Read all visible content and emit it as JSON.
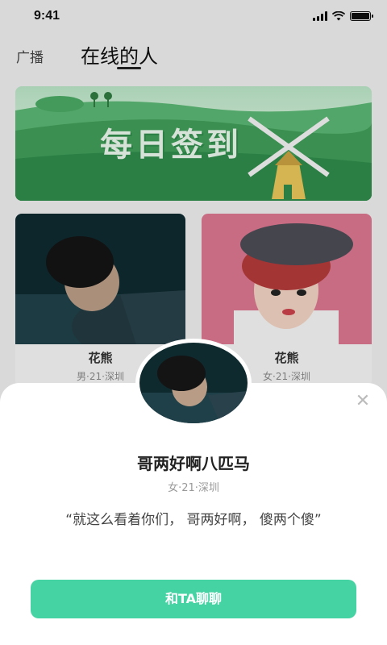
{
  "status_bar": {
    "time": "9:41"
  },
  "tabs": {
    "broadcast": "广播",
    "online": "在线的人"
  },
  "banner": {
    "title": "每日签到"
  },
  "cards": [
    {
      "name": "花熊",
      "meta": "男·21·深圳"
    },
    {
      "name": "花熊",
      "meta": "女·21·深圳"
    }
  ],
  "profile": {
    "name": "哥两好啊八匹马",
    "meta": "女·21·深圳",
    "quote": "“就这么看着你们， 哥两好啊， 傻两个傻”"
  },
  "actions": {
    "chat_label": "和TA聊聊"
  },
  "colors": {
    "accent": "#46d3a4",
    "banner_green": "#3d9a55"
  }
}
